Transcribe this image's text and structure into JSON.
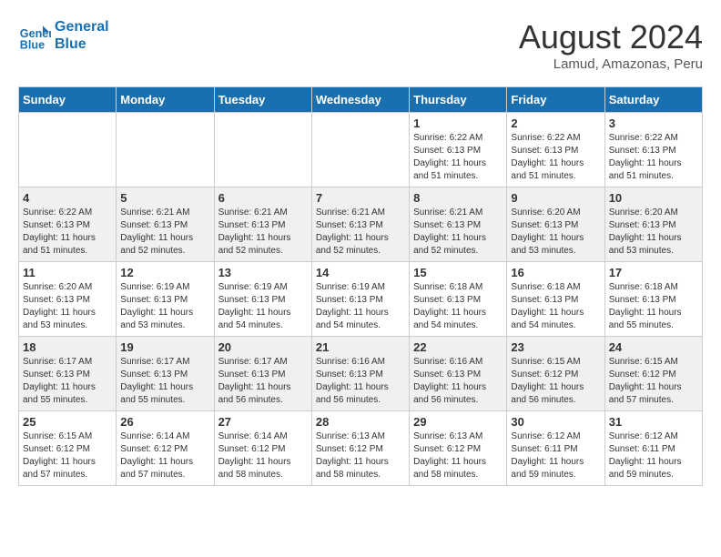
{
  "logo": {
    "line1": "General",
    "line2": "Blue"
  },
  "title": "August 2024",
  "location": "Lamud, Amazonas, Peru",
  "days_header": [
    "Sunday",
    "Monday",
    "Tuesday",
    "Wednesday",
    "Thursday",
    "Friday",
    "Saturday"
  ],
  "weeks": [
    {
      "alt": false,
      "days": [
        {
          "num": "",
          "info": ""
        },
        {
          "num": "",
          "info": ""
        },
        {
          "num": "",
          "info": ""
        },
        {
          "num": "",
          "info": ""
        },
        {
          "num": "1",
          "info": "Sunrise: 6:22 AM\nSunset: 6:13 PM\nDaylight: 11 hours\nand 51 minutes."
        },
        {
          "num": "2",
          "info": "Sunrise: 6:22 AM\nSunset: 6:13 PM\nDaylight: 11 hours\nand 51 minutes."
        },
        {
          "num": "3",
          "info": "Sunrise: 6:22 AM\nSunset: 6:13 PM\nDaylight: 11 hours\nand 51 minutes."
        }
      ]
    },
    {
      "alt": true,
      "days": [
        {
          "num": "4",
          "info": "Sunrise: 6:22 AM\nSunset: 6:13 PM\nDaylight: 11 hours\nand 51 minutes."
        },
        {
          "num": "5",
          "info": "Sunrise: 6:21 AM\nSunset: 6:13 PM\nDaylight: 11 hours\nand 52 minutes."
        },
        {
          "num": "6",
          "info": "Sunrise: 6:21 AM\nSunset: 6:13 PM\nDaylight: 11 hours\nand 52 minutes."
        },
        {
          "num": "7",
          "info": "Sunrise: 6:21 AM\nSunset: 6:13 PM\nDaylight: 11 hours\nand 52 minutes."
        },
        {
          "num": "8",
          "info": "Sunrise: 6:21 AM\nSunset: 6:13 PM\nDaylight: 11 hours\nand 52 minutes."
        },
        {
          "num": "9",
          "info": "Sunrise: 6:20 AM\nSunset: 6:13 PM\nDaylight: 11 hours\nand 53 minutes."
        },
        {
          "num": "10",
          "info": "Sunrise: 6:20 AM\nSunset: 6:13 PM\nDaylight: 11 hours\nand 53 minutes."
        }
      ]
    },
    {
      "alt": false,
      "days": [
        {
          "num": "11",
          "info": "Sunrise: 6:20 AM\nSunset: 6:13 PM\nDaylight: 11 hours\nand 53 minutes."
        },
        {
          "num": "12",
          "info": "Sunrise: 6:19 AM\nSunset: 6:13 PM\nDaylight: 11 hours\nand 53 minutes."
        },
        {
          "num": "13",
          "info": "Sunrise: 6:19 AM\nSunset: 6:13 PM\nDaylight: 11 hours\nand 54 minutes."
        },
        {
          "num": "14",
          "info": "Sunrise: 6:19 AM\nSunset: 6:13 PM\nDaylight: 11 hours\nand 54 minutes."
        },
        {
          "num": "15",
          "info": "Sunrise: 6:18 AM\nSunset: 6:13 PM\nDaylight: 11 hours\nand 54 minutes."
        },
        {
          "num": "16",
          "info": "Sunrise: 6:18 AM\nSunset: 6:13 PM\nDaylight: 11 hours\nand 54 minutes."
        },
        {
          "num": "17",
          "info": "Sunrise: 6:18 AM\nSunset: 6:13 PM\nDaylight: 11 hours\nand 55 minutes."
        }
      ]
    },
    {
      "alt": true,
      "days": [
        {
          "num": "18",
          "info": "Sunrise: 6:17 AM\nSunset: 6:13 PM\nDaylight: 11 hours\nand 55 minutes."
        },
        {
          "num": "19",
          "info": "Sunrise: 6:17 AM\nSunset: 6:13 PM\nDaylight: 11 hours\nand 55 minutes."
        },
        {
          "num": "20",
          "info": "Sunrise: 6:17 AM\nSunset: 6:13 PM\nDaylight: 11 hours\nand 56 minutes."
        },
        {
          "num": "21",
          "info": "Sunrise: 6:16 AM\nSunset: 6:13 PM\nDaylight: 11 hours\nand 56 minutes."
        },
        {
          "num": "22",
          "info": "Sunrise: 6:16 AM\nSunset: 6:13 PM\nDaylight: 11 hours\nand 56 minutes."
        },
        {
          "num": "23",
          "info": "Sunrise: 6:15 AM\nSunset: 6:12 PM\nDaylight: 11 hours\nand 56 minutes."
        },
        {
          "num": "24",
          "info": "Sunrise: 6:15 AM\nSunset: 6:12 PM\nDaylight: 11 hours\nand 57 minutes."
        }
      ]
    },
    {
      "alt": false,
      "days": [
        {
          "num": "25",
          "info": "Sunrise: 6:15 AM\nSunset: 6:12 PM\nDaylight: 11 hours\nand 57 minutes."
        },
        {
          "num": "26",
          "info": "Sunrise: 6:14 AM\nSunset: 6:12 PM\nDaylight: 11 hours\nand 57 minutes."
        },
        {
          "num": "27",
          "info": "Sunrise: 6:14 AM\nSunset: 6:12 PM\nDaylight: 11 hours\nand 58 minutes."
        },
        {
          "num": "28",
          "info": "Sunrise: 6:13 AM\nSunset: 6:12 PM\nDaylight: 11 hours\nand 58 minutes."
        },
        {
          "num": "29",
          "info": "Sunrise: 6:13 AM\nSunset: 6:12 PM\nDaylight: 11 hours\nand 58 minutes."
        },
        {
          "num": "30",
          "info": "Sunrise: 6:12 AM\nSunset: 6:11 PM\nDaylight: 11 hours\nand 59 minutes."
        },
        {
          "num": "31",
          "info": "Sunrise: 6:12 AM\nSunset: 6:11 PM\nDaylight: 11 hours\nand 59 minutes."
        }
      ]
    }
  ]
}
